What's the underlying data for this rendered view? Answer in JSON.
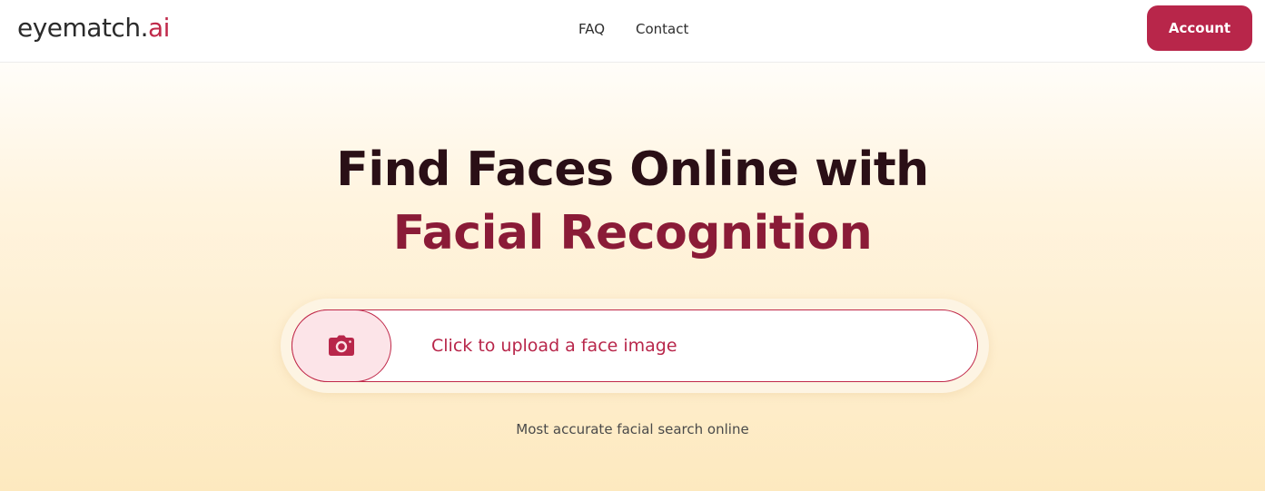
{
  "header": {
    "logo_main": "eyematch",
    "logo_dot": ".",
    "logo_accent": "ai",
    "nav": [
      {
        "label": "FAQ"
      },
      {
        "label": "Contact"
      }
    ],
    "account_label": "Account"
  },
  "hero": {
    "title_line1": "Find Faces Online with",
    "title_line2": "Facial Recognition"
  },
  "upload": {
    "icon": "camera-icon",
    "label": "Click to upload a face image"
  },
  "tagline": "Most accurate facial search online",
  "colors": {
    "brand": "#b8264a",
    "headline_dark": "#2a0f16",
    "headline_accent": "#8a1b37",
    "camera_bg": "#fce4e8"
  }
}
